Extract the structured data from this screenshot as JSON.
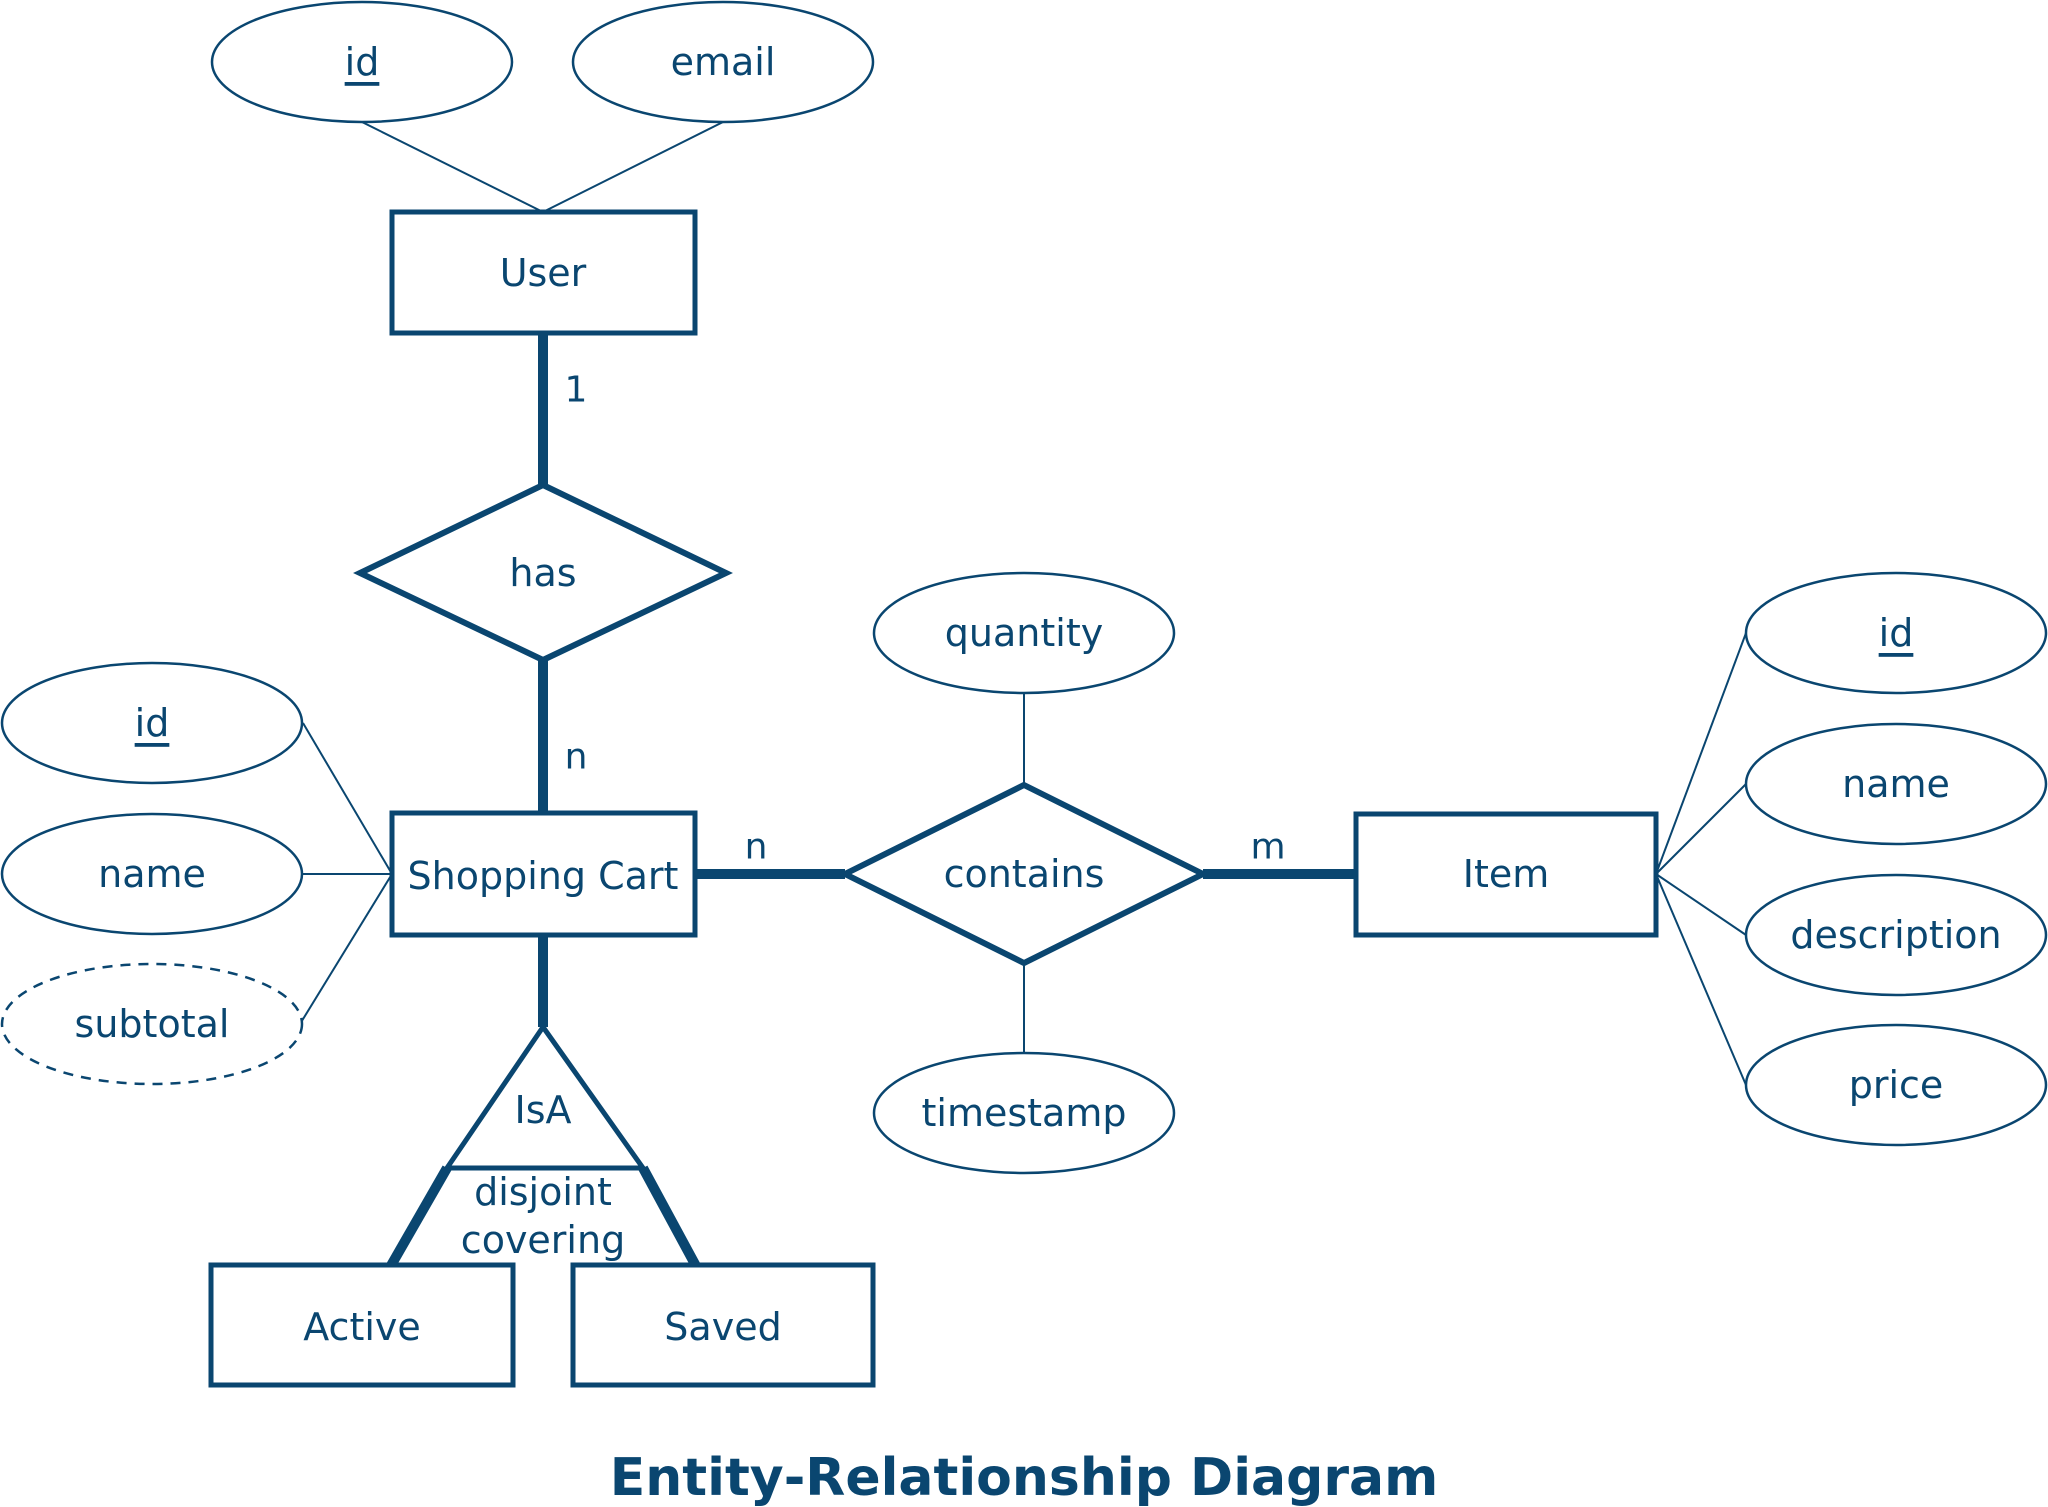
{
  "title": "Entity-Relationship Diagram",
  "colors": {
    "stroke": "#0a4670",
    "background": "#ffffff"
  },
  "entities": {
    "user": "User",
    "shopping_cart": "Shopping Cart",
    "item": "Item",
    "active": "Active",
    "saved": "Saved"
  },
  "relationships": {
    "has": "has",
    "contains": "contains"
  },
  "isa": {
    "label": "IsA",
    "constraint_1": "disjoint",
    "constraint_2": "covering"
  },
  "attributes": {
    "user": [
      {
        "name": "id",
        "key": true
      },
      {
        "name": "email",
        "key": false
      }
    ],
    "shopping_cart": [
      {
        "name": "id",
        "key": true
      },
      {
        "name": "name",
        "key": false
      },
      {
        "name": "subtotal",
        "key": false,
        "derived": true
      }
    ],
    "contains": [
      {
        "name": "quantity",
        "key": false
      },
      {
        "name": "timestamp",
        "key": false
      }
    ],
    "item": [
      {
        "name": "id",
        "key": true
      },
      {
        "name": "name",
        "key": false
      },
      {
        "name": "description",
        "key": false
      },
      {
        "name": "price",
        "key": false
      }
    ]
  },
  "cardinalities": {
    "user_has": "1",
    "has_cart": "n",
    "cart_contains": "n",
    "contains_item": "m"
  }
}
